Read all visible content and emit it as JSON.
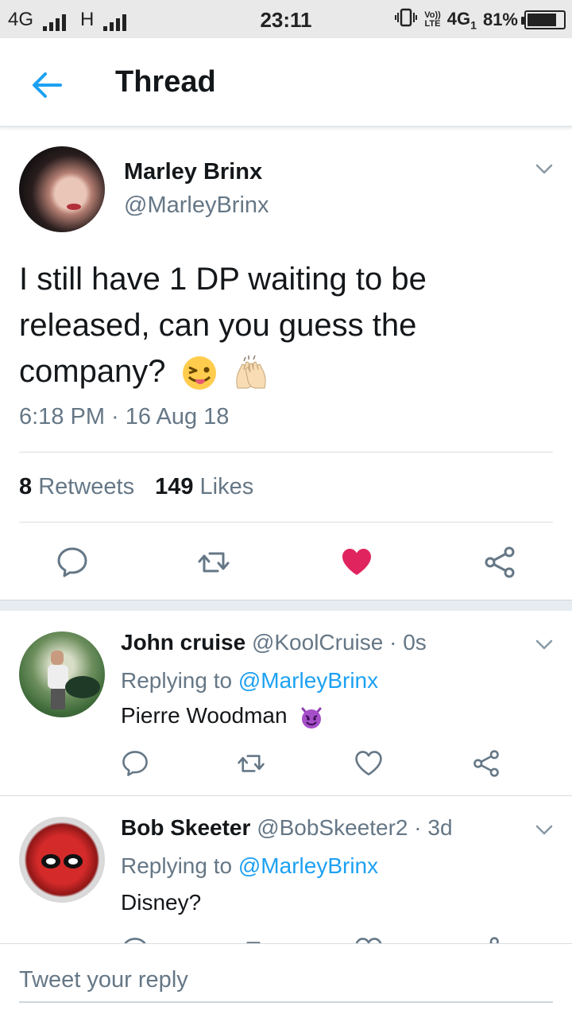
{
  "status_bar": {
    "left_network_1": "4G",
    "left_network_2": "H",
    "time": "23:11",
    "volte_top": "Vo))",
    "volte_bottom": "LTE",
    "network_right": "4G",
    "network_right_sub": "1",
    "battery": "81%",
    "battery_level": 0.81
  },
  "header": {
    "title": "Thread",
    "back_icon": "arrow-left-icon"
  },
  "main_tweet": {
    "name": "Marley Brinx",
    "handle": "@MarleyBrinx",
    "text": "I still have 1 DP waiting to be released, can you guess the company?",
    "emojis": [
      "winking-face-with-tongue-emoji",
      "raising-hands-emoji"
    ],
    "timestamp": "6:18 PM · 16 Aug 18",
    "retweet_count": "8",
    "retweet_label": "Retweets",
    "like_count": "149",
    "like_label": "Likes",
    "liked": true
  },
  "replies": [
    {
      "name": "John cruise",
      "handle": "@KoolCruise · 0s",
      "replying_prefix": "Replying to",
      "replying_to": "@MarleyBrinx",
      "text": "Pierre Woodman",
      "emoji": "smiling-face-with-horns-emoji"
    },
    {
      "name": "Bob Skeeter",
      "handle": "@BobSkeeter2 · 3d",
      "replying_prefix": "Replying to",
      "replying_to": "@MarleyBrinx",
      "text": "Disney?"
    }
  ],
  "composer": {
    "placeholder": "Tweet your reply"
  },
  "colors": {
    "accent": "#1da1f2",
    "like": "#e0245e",
    "secondary_text": "#657786",
    "primary_text": "#14171a"
  }
}
